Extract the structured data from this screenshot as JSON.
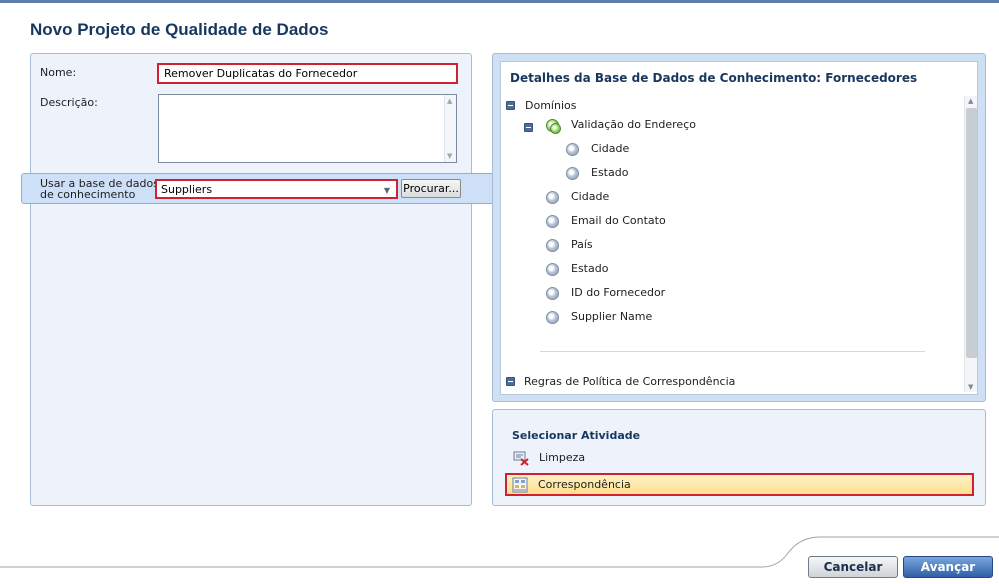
{
  "page_title": "Novo Projeto de Qualidade de Dados",
  "form": {
    "name_label": "Nome:",
    "name_value": "Remover Duplicatas do Fornecedor",
    "description_label": "Descrição:",
    "description_value": "",
    "kb_label_line1": "Usar a base de dados",
    "kb_label_line2": "de conhecimento",
    "kb_selected": "Suppliers",
    "browse_label": "Procurar..."
  },
  "details": {
    "title": "Detalhes da Base de Dados de Conhecimento: Fornecedores",
    "domains_label": "Domínios",
    "composite": {
      "label": "Validação do Endereço",
      "children": [
        "Cidade",
        "Estado"
      ]
    },
    "domains": [
      "Cidade",
      "Email do Contato",
      "País",
      "Estado",
      "ID do Fornecedor",
      "Supplier Name"
    ],
    "matching_rules_label": "Regras de Política de Correspondência"
  },
  "activity": {
    "title": "Selecionar Atividade",
    "items": [
      "Limpeza",
      "Correspondência"
    ],
    "selected_index": 1
  },
  "footer": {
    "cancel_label": "Cancelar",
    "next_label": "Avançar"
  },
  "colors": {
    "title_blue": "#17375e",
    "highlight_red": "#d2202f",
    "selected_fill": "#fddf8d"
  }
}
